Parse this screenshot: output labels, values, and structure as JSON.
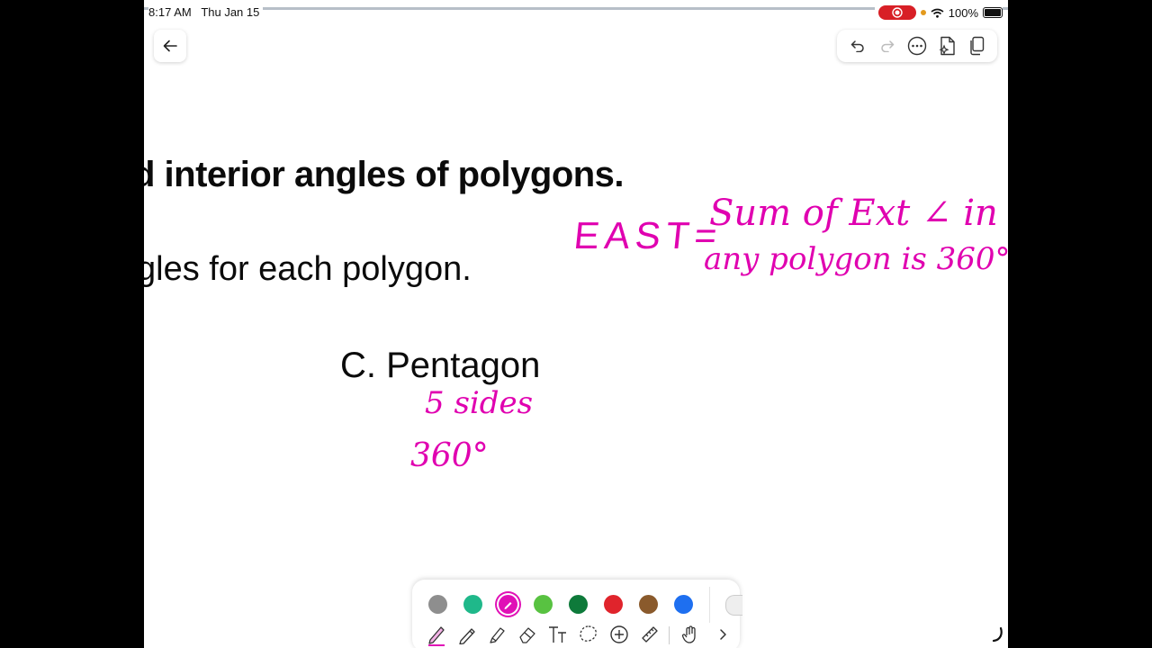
{
  "status_bar": {
    "time": "8:17 AM",
    "date": "Thu Jan 15",
    "battery": "100%",
    "icons": [
      "record-icon",
      "location-icon",
      "wifi-icon",
      "battery-icon"
    ]
  },
  "toolbar": {
    "icons": [
      "back-arrow-icon",
      "undo-icon",
      "redo-icon",
      "more-icon",
      "ai-sparkle-icon",
      "pages-icon"
    ]
  },
  "slide": {
    "line1": "d interior angles of polygons.",
    "line2": "gles for each polygon.",
    "line3": "C. Pentagon"
  },
  "handwriting": {
    "east": "EAST=",
    "sum": "Sum of Ext ∠ in",
    "polygon": "any polygon is 360°",
    "sides": "5 sides",
    "degrees": "360°"
  },
  "palette": {
    "colors": [
      "#8e8e8e",
      "#1fb88a",
      "#e010b6",
      "#58c241",
      "#0e7a3a",
      "#e0242c",
      "#8a5a2c",
      "#1e6ff0"
    ],
    "selected_color": "#e010b6",
    "tools": [
      "pen-icon",
      "pencil-icon",
      "highlighter-icon",
      "eraser-icon",
      "text-icon",
      "lasso-icon",
      "add-icon",
      "ruler-icon",
      "hand-icon",
      "chevron-right-icon"
    ]
  },
  "colors": {
    "ink": "#e000b0",
    "record": "#d81f26"
  }
}
